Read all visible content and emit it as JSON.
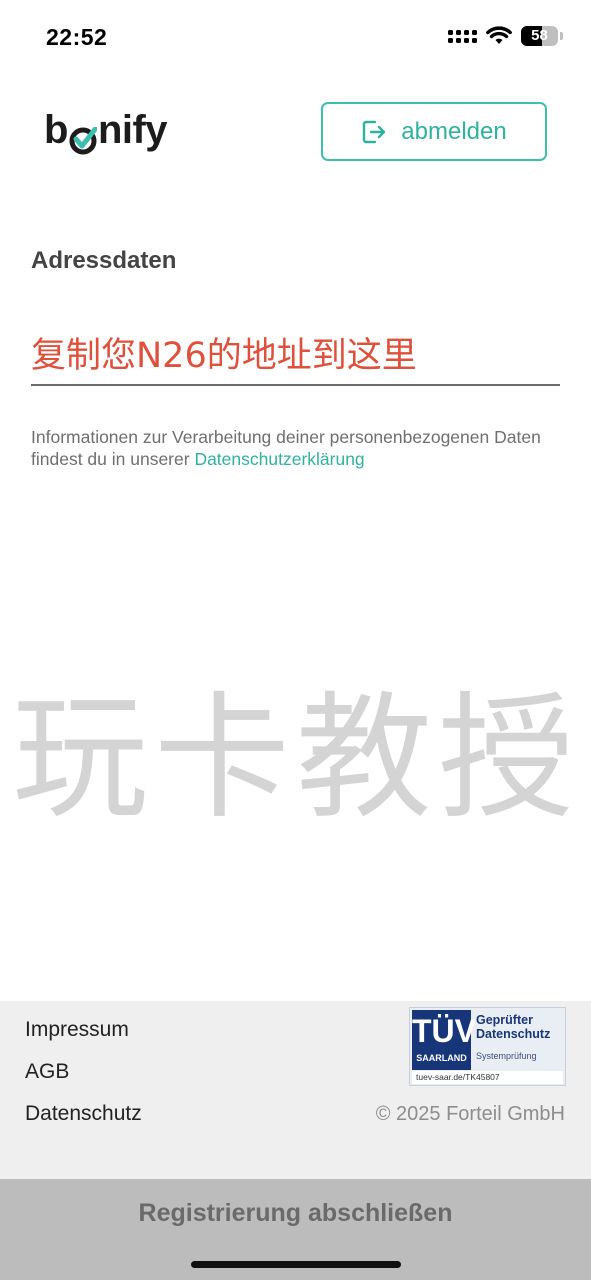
{
  "status_bar": {
    "time": "22:52",
    "battery": "58",
    "battery_level_percent": 58,
    "icons": [
      "cellular-signal-icon",
      "wifi-icon",
      "battery-icon"
    ]
  },
  "header": {
    "logo_text_left": "b",
    "logo_text_right": "nify",
    "logout_label": "abmelden",
    "logout_icon": "logout-icon"
  },
  "form": {
    "section_label": "Adressdaten",
    "address_value": "复制您N26的地址到这里",
    "privacy_text": "Informationen zur Verarbeitung deiner personenbezogenen Daten findest du in unserer ",
    "privacy_link": "Datenschutzerklärung"
  },
  "watermark": "玩卡教授",
  "footer": {
    "links": [
      "Impressum",
      "AGB",
      "Datenschutz"
    ],
    "badge": {
      "mark_big": "TÜV",
      "mark_small": "SAARLAND",
      "title_line1": "Geprüfter",
      "title_line2": "Datenschutz",
      "subtitle": "Systemprüfung",
      "url": "tuev-saar.de/TK45807"
    },
    "copyright": "© 2025 Forteil GmbH"
  },
  "submit": {
    "label": "Registrierung abschließen"
  },
  "colors": {
    "accent": "#3cbfae",
    "input_text": "#e0503a",
    "footer_bg": "#efefef",
    "submit_bg": "#bcbcbc"
  }
}
